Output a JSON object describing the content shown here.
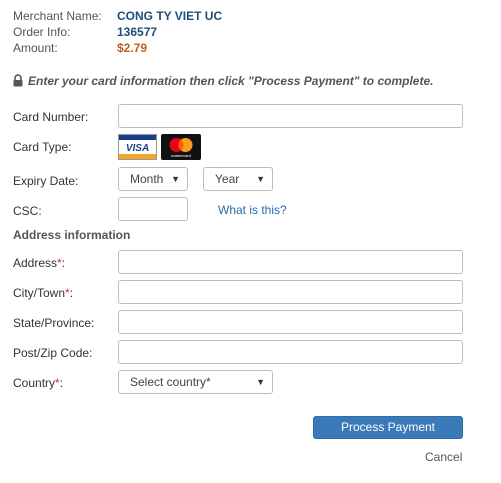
{
  "merchant": {
    "name_label": "Merchant Name:",
    "name_value": "CONG TY VIET UC",
    "order_label": "Order Info:",
    "order_value": "136577",
    "amount_label": "Amount:",
    "amount_value": "$2.79"
  },
  "colors": {
    "merchant_value": "#1e4d7b",
    "amount_value": "#c0601a",
    "button_bg": "#3a7ab8"
  },
  "instruction": {
    "icon": "lock-icon",
    "text": "Enter your card information then click \"Process Payment\" to complete."
  },
  "card": {
    "number_label": "Card Number:",
    "type_label": "Card Type:",
    "brands": [
      "VISA",
      "mastercard"
    ],
    "expiry_label": "Expiry Date:",
    "month_selected": "Month",
    "year_selected": "Year",
    "csc_label": "CSC:",
    "whatis_link": "What is this?"
  },
  "address": {
    "section_title": "Address information",
    "address_label": "Address",
    "city_label": "City/Town",
    "state_label": "State/Province:",
    "zip_label": "Post/Zip Code:",
    "country_label": "Country",
    "required_mark": "*",
    "label_suffix": ":",
    "country_selected": "Select country*"
  },
  "actions": {
    "process_label": "Process Payment",
    "cancel_label": "Cancel"
  }
}
